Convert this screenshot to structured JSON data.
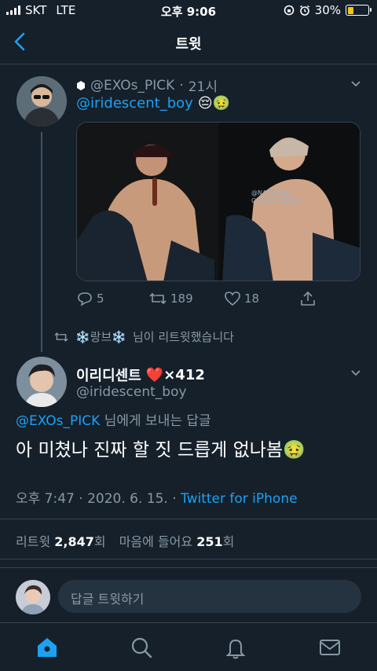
{
  "status_bar": {
    "carrier": "SKT",
    "network": "LTE",
    "time": "오후 9:06",
    "battery": "30%",
    "battery_level": 0.3
  },
  "header": {
    "title": "트윗"
  },
  "parent_tweet": {
    "author_handle": "@EXOs_PICK",
    "time_ago": "21시",
    "mention": "@iridescent_boy",
    "emojis": "😔🤢",
    "stats": {
      "replies": "5",
      "retweets": "189",
      "likes": "18"
    }
  },
  "retweet_notice": {
    "name": "❄️랑브❄️",
    "suffix": "님이 리트윗했습니다"
  },
  "main_tweet": {
    "display_name": "이리디센트",
    "name_badge": "❤️×412",
    "handle": "@iridescent_boy",
    "reply_to_handle": "@EXOs_PICK",
    "reply_to_suffix": "님에게 보내는 답글",
    "text": "아 미쳤나 진짜 할 짓 드릅게 없나봄🤢",
    "timestamp": "오후 7:47 · 2020. 6. 15. · ",
    "source": "Twitter for iPhone",
    "stats": {
      "retweet_label": "리트윗",
      "retweet_count": "2,847",
      "retweet_unit": "회",
      "like_label": "마음에 들어요",
      "like_count": "251",
      "like_unit": "회"
    }
  },
  "reply_box": {
    "placeholder": "답글 트윗하기"
  },
  "media": {
    "watermark": "@NAMJOONX\nON INSTAGRAM"
  },
  "colors": {
    "background": "#15202b",
    "accent": "#1da1f2",
    "muted": "#8899a6",
    "divider": "#38444d"
  }
}
